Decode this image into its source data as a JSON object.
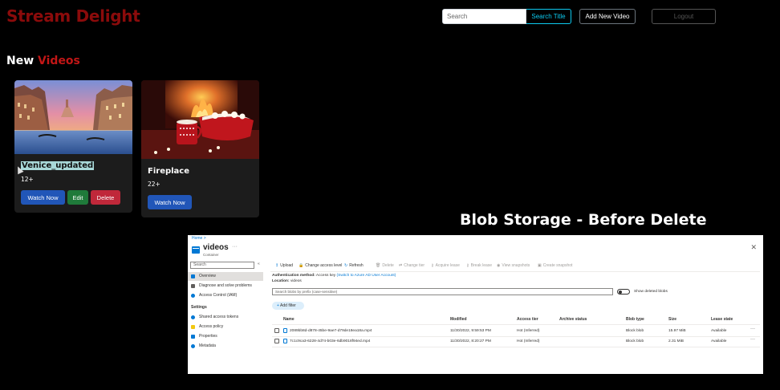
{
  "header": {
    "brand": "Stream Delight",
    "search_placeholder": "Search",
    "search_button": "Search Title",
    "add_button": "Add New Video",
    "logout_button": "Logout"
  },
  "section": {
    "title_word1": "New",
    "title_word2": "Videos"
  },
  "videos": [
    {
      "title": "Venice_updated",
      "rating": "12+",
      "watch_label": "Watch Now",
      "edit_label": "Edit",
      "delete_label": "Delete",
      "thumbnail_icon": "venice-canal-image"
    },
    {
      "title": "Fireplace",
      "rating": "22+",
      "watch_label": "Watch Now",
      "thumbnail_icon": "fireplace-popcorn-image"
    }
  ],
  "caption": "Blob Storage - Before Delete",
  "azure": {
    "breadcrumb": "Home >",
    "title": "videos",
    "title_more": "···",
    "subtitle": "Container",
    "close": "✕",
    "sidebar": {
      "search_placeholder": "Search",
      "collapse": "«",
      "items": [
        {
          "label": "Overview",
          "icon": "overview-icon",
          "color": "#0078d4"
        },
        {
          "label": "Diagnose and solve problems",
          "icon": "wrench-icon",
          "color": "#605e5c"
        },
        {
          "label": "Access Control (IAM)",
          "icon": "people-icon",
          "color": "#0078d4"
        }
      ],
      "settings_group": "Settings",
      "settings_items": [
        {
          "label": "Shared access tokens",
          "icon": "link-icon",
          "color": "#0078d4"
        },
        {
          "label": "Access policy",
          "icon": "key-icon",
          "color": "#f2c811"
        },
        {
          "label": "Properties",
          "icon": "properties-icon",
          "color": "#0078d4"
        },
        {
          "label": "Metadata",
          "icon": "info-icon",
          "color": "#0078d4"
        }
      ]
    },
    "toolbar": [
      {
        "label": "Upload",
        "icon": "↥",
        "enabled": true
      },
      {
        "label": "Change access level",
        "icon": "🔒",
        "enabled": true
      },
      {
        "label": "Refresh",
        "icon": "↻",
        "enabled": true
      },
      {
        "label": "Delete",
        "icon": "🗑",
        "enabled": false
      },
      {
        "label": "Change tier",
        "icon": "⇄",
        "enabled": false
      },
      {
        "label": "Acquire lease",
        "icon": "⚷",
        "enabled": false
      },
      {
        "label": "Break lease",
        "icon": "⚷",
        "enabled": false
      },
      {
        "label": "View snapshots",
        "icon": "◉",
        "enabled": false
      },
      {
        "label": "Create snapshot",
        "icon": "▣",
        "enabled": false
      }
    ],
    "auth_label": "Authentication method:",
    "auth_value": "Access key",
    "auth_link": "(Switch to Azure AD User Account)",
    "location_label": "Location:",
    "location_value": "videos",
    "blob_search_placeholder": "Search blobs by prefix (case-sensitive)",
    "show_deleted": "Show deleted blobs",
    "add_filter": "Add filter",
    "columns": [
      "Name",
      "Modified",
      "Access tier",
      "Archive status",
      "Blob type",
      "Size",
      "Lease state"
    ],
    "rows": [
      {
        "name": "2089bb8d-d878-45be-9ae7-d79de18ea18a.mp4",
        "modified": "11/30/2022, 9:59:53 PM",
        "tier": "Hot (Inferred)",
        "archive": "",
        "type": "Block blob",
        "size": "15.97 MiB",
        "lease": "Available"
      },
      {
        "name": "7c1c9ca3-6228-4d74-b03e-6db9018f94ed.mp4",
        "modified": "11/30/2022, 8:20:27 PM",
        "tier": "Hot (Inferred)",
        "archive": "",
        "type": "Block blob",
        "size": "2.31 MiB",
        "lease": "Available"
      }
    ],
    "row_more": "···"
  }
}
